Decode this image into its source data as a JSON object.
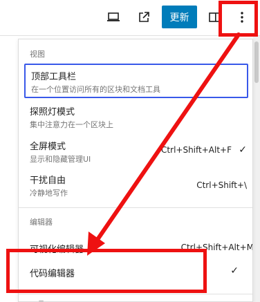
{
  "toolbar": {
    "preview_icon": "laptop-icon",
    "external_icon": "external-link-icon",
    "update_label": "更新",
    "sidebar_icon": "sidebar-toggle-icon",
    "options_icon": "more-vertical-icon"
  },
  "menu": {
    "view_group": {
      "label": "视图",
      "items": [
        {
          "title": "顶部工具栏",
          "description": "在一个位置访问所有的区块和文档工具",
          "shortcut": "",
          "checked": false
        },
        {
          "title": "探照灯模式",
          "description": "集中注意力在一个区块上",
          "shortcut": "",
          "checked": false
        },
        {
          "title": "全屏模式",
          "description": "显示和隐藏管理UI",
          "shortcut": "Ctrl+Shift+Alt+F",
          "checked": true
        },
        {
          "title": "干扰自由",
          "description": "冷静地写作",
          "shortcut": "Ctrl+Shift+\\",
          "checked": false
        }
      ]
    },
    "editor_group": {
      "label": "编辑器",
      "items": [
        {
          "title": "可视化编辑器",
          "shortcut": "Ctrl+Shift+Alt+M",
          "checked": false
        },
        {
          "title": "代码编辑器",
          "shortcut": "",
          "checked": true
        }
      ]
    },
    "tools_group": {
      "label": "工具"
    },
    "check_mark": "✓"
  },
  "colors": {
    "accent": "#007cba",
    "focus": "#3858e9",
    "annotation": "#ee1111"
  }
}
